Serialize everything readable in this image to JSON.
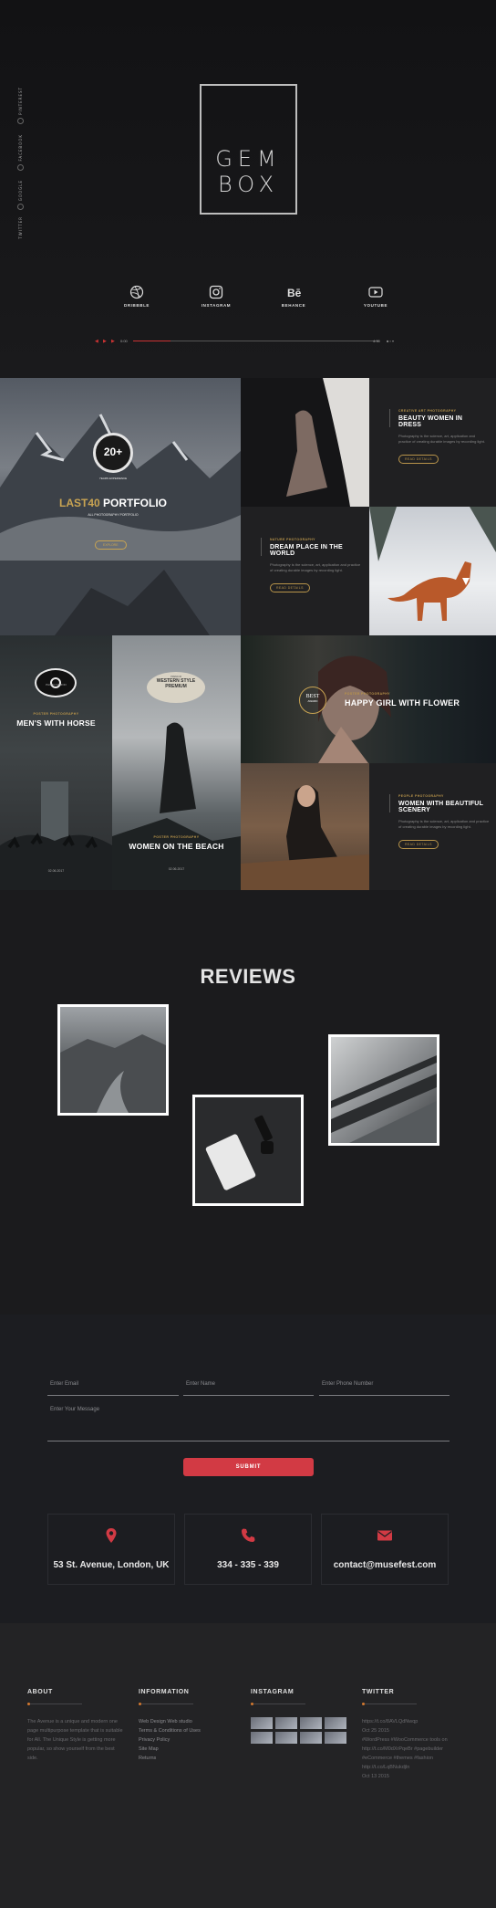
{
  "hero": {
    "side_social": [
      "PINTEREST",
      "FACEBOOK",
      "GOOGLE",
      "TWITTER"
    ],
    "logo_line1": "GEM",
    "logo_line2": "BOX",
    "socials": [
      {
        "label": "DRIBBBLE",
        "icon": "dribbble-icon"
      },
      {
        "label": "INSTAGRAM",
        "icon": "instagram-icon"
      },
      {
        "label": "BEHANCE",
        "icon": "behance-icon"
      },
      {
        "label": "YOUTUBE",
        "icon": "youtube-icon"
      }
    ],
    "player": {
      "current": "0:00",
      "total": "4:30",
      "progress": 0.15
    }
  },
  "portfolio": {
    "last40": {
      "badge": "20+",
      "badge_sub": "YEARS EXPERIENCE",
      "title_accent": "LAST40",
      "title": "PORTFOLIO",
      "subtitle": "ALL PHOTOGRAPHY PORTFOLIO",
      "button": "EXPLORE"
    },
    "dress": {
      "tag": "CREATIVE ART PHOTOGRAPHY",
      "title": "BEAUTY WOMEN IN DRESS",
      "desc": "Photography is the science, art, application and practice of creating durable images by recording light.",
      "button": "READ DETAILS"
    },
    "world": {
      "tag": "NATURE PHOTOGRAPHY",
      "title": "DREAM PLACE IN THE WORLD",
      "desc": "Photography is the science, art, application and practice of creating durable images by recording light.",
      "button": "READ DETAILS"
    },
    "horse": {
      "logo": "PHOTO STUDIO",
      "tag": "POSTER PHOTOGRAPHY",
      "title": "MEN'S WITH HORSE",
      "date": "02.06.2017"
    },
    "beach": {
      "badge_l1": "PREMIUM",
      "badge_l2": "WESTERN STYLE",
      "badge_l3": "PREMIUM",
      "tag": "POSTER PHOTOGRAPHY",
      "title": "WOMEN ON THE BEACH",
      "date": "02.06.2017"
    },
    "girl": {
      "badge_l1": "BEST",
      "badge_l2": "AWARD",
      "tag": "POSTER PHOTOGRAPHY",
      "title": "HAPPY GIRL WITH FLOWER"
    },
    "winter": {
      "tag": "PEOPLE PHOTOGRAPHY",
      "title": "WOMEN WITH BEAUTIFUL SCENERY",
      "desc": "Photography is the science, art, application and practice of creating durable images by recording light.",
      "button": "READ DETAILS"
    }
  },
  "reviews": {
    "title": "REVIEWS"
  },
  "contact": {
    "email_placeholder": "Enter Email",
    "name_placeholder": "Enter Name",
    "phone_placeholder": "Enter Phone Number",
    "message_placeholder": "Enter Your Message",
    "submit": "SUBMIT",
    "address": "53 St. Avenue, London, UK",
    "phone": "334 - 335 - 339",
    "email": "contact@musefest.com",
    "accent": "#d23a44"
  },
  "footer": {
    "about": {
      "heading": "ABOUT",
      "text": "The Avenue is a unique and modern one page multipurpose template that is suitable for All. The Unique Style is getting more popular, so show yourself from the best side."
    },
    "information": {
      "heading": "INFORMATION",
      "links": [
        "Web Design Web studio",
        "Terms & Conditions of Uses",
        "Privacy Policy",
        "Site Map",
        "Returns"
      ]
    },
    "instagram": {
      "heading": "INSTAGRAM"
    },
    "twitter": {
      "heading": "TWITTER",
      "tweets": [
        "https://t.co/8AVLQdNwqp",
        "Oct 25 2015",
        "#WordPress #WooCommerce tools on",
        "http://t.co/M0dXrPqeBr #pagebuilder",
        "#eCommerce #themes #fashion",
        "http://t.co/LqBNukdjln",
        "Oct 13 2015"
      ]
    },
    "accent": "#d2782f"
  }
}
